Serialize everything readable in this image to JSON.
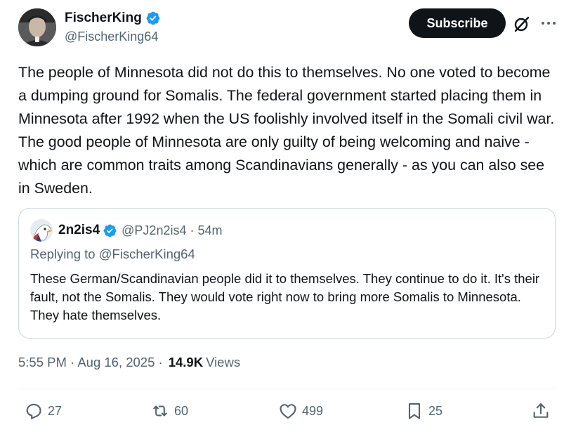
{
  "author": {
    "display_name": "FischerKing",
    "handle": "@FischerKing64",
    "verified_icon": "verified-badge-icon"
  },
  "header_actions": {
    "subscribe_label": "Subscribe",
    "grok_icon": "grok-icon",
    "more_icon": "more-icon"
  },
  "tweet": {
    "text": "The people of Minnesota did not do this to themselves. No one voted to become a dumping ground for Somalis. The federal government started placing them in Minnesota after 1992 when the US foolishly involved itself in the Somali civil war. The good people of Minnesota are only guilty of being welcoming and naive - which are common traits among Scandinavians generally - as you can also see in Sweden."
  },
  "quote": {
    "display_name": "2n2is4",
    "handle_time": "@PJ2n2is4 · 54m",
    "replying_prefix": "Replying to ",
    "replying_to": "@FischerKing64",
    "text": "These German/Scandinavian people did it to themselves. They continue to do it.  It's their fault, not the Somalis. They would vote right now to bring more Somalis to Minnesota. They hate themselves."
  },
  "meta": {
    "timestamp": "5:55 PM · Aug 16, 2025 ·",
    "views_count": "14.9K",
    "views_label": "Views"
  },
  "actions": {
    "replies": "27",
    "reposts": "60",
    "likes": "499",
    "bookmarks": "25"
  },
  "colors": {
    "text": "#0f1419",
    "secondary": "#536471",
    "verified": "#1d9bf0",
    "border": "#cfd9de",
    "button_bg": "#0f1419"
  }
}
